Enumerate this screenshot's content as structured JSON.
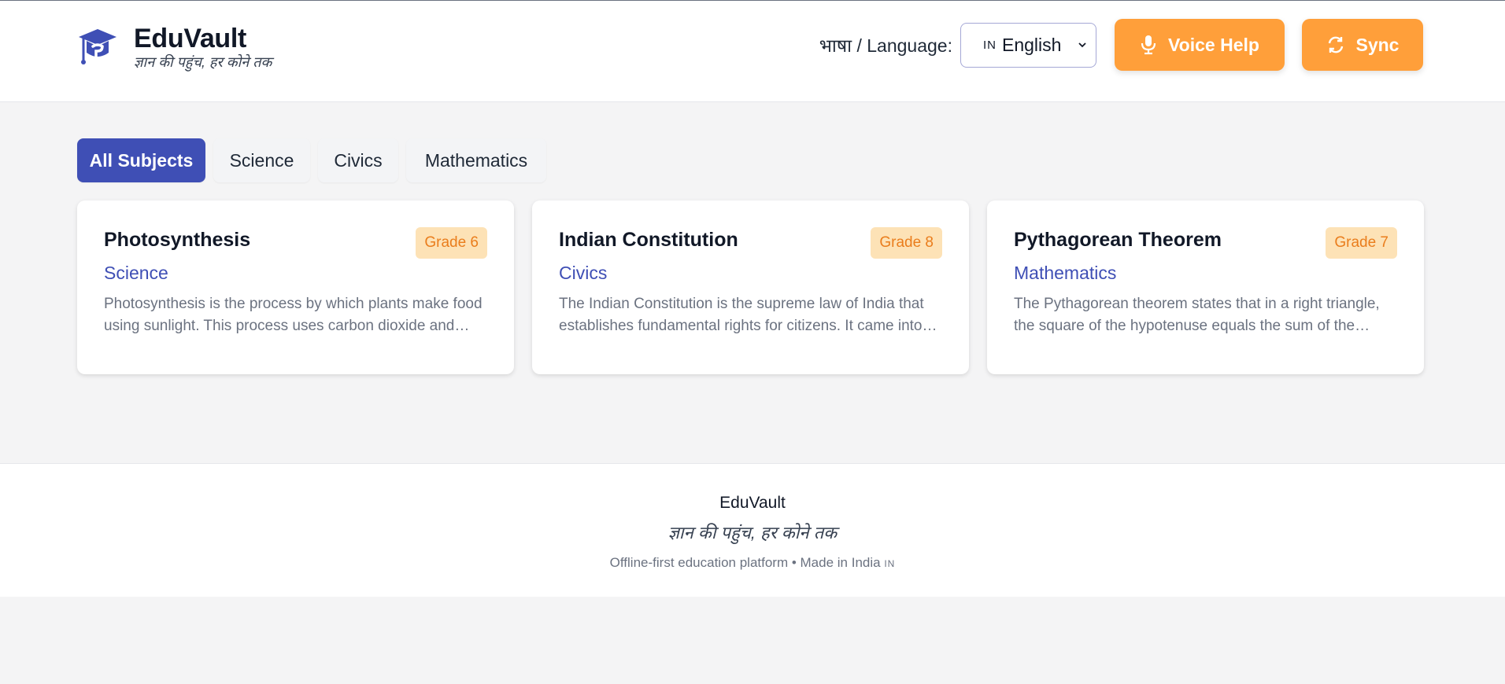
{
  "header": {
    "brand_title": "EduVault",
    "brand_tagline": "ज्ञान की पहुंच, हर कोने तक",
    "language_label": "भाषा / Language:",
    "language_select": {
      "flag": "IN",
      "value": "English"
    },
    "voice_button": "Voice Help",
    "sync_button": "Sync"
  },
  "tabs": [
    {
      "label": "All Subjects",
      "active": true
    },
    {
      "label": "Science",
      "active": false
    },
    {
      "label": "Civics",
      "active": false
    },
    {
      "label": "Mathematics",
      "active": false
    }
  ],
  "cards": [
    {
      "title": "Photosynthesis",
      "grade": "Grade 6",
      "subject": "Science",
      "description": "Photosynthesis is the process by which plants make food using sunlight. This process uses carbon dioxide and water."
    },
    {
      "title": "Indian Constitution",
      "grade": "Grade 8",
      "subject": "Civics",
      "description": "The Indian Constitution is the supreme law of India that establishes fundamental rights for citizens. It came into effect."
    },
    {
      "title": "Pythagorean Theorem",
      "grade": "Grade 7",
      "subject": "Mathematics",
      "description": "The Pythagorean theorem states that in a right triangle, the square of the hypotenuse equals the sum of the squares."
    }
  ],
  "footer": {
    "title": "EduVault",
    "tagline": "ज्ञान की पहुंच, हर कोने तक",
    "note": "Offline-first education platform • Made in India",
    "note_flag": "IN"
  },
  "colors": {
    "primary": "#3f4fb5",
    "accent": "#ff9f3a",
    "grade_bg": "#fde2b6",
    "grade_text": "#ea7d1c"
  },
  "icons": {
    "logo": "graduation-cap-icon",
    "voice": "microphone-icon",
    "sync": "sync-icon",
    "select": "chevron-down-icon"
  }
}
